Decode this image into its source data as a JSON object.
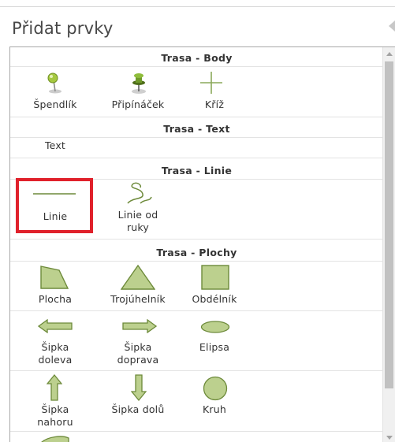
{
  "header": {
    "title": "Přidat prvky"
  },
  "sections": {
    "body": {
      "title": "Trasa - Body",
      "items": [
        {
          "label": "Špendlík",
          "icon": "pushpin-icon"
        },
        {
          "label": "Připínáček",
          "icon": "thumbtack-icon"
        },
        {
          "label": "Kříž",
          "icon": "cross-icon"
        }
      ]
    },
    "text": {
      "title": "Trasa - Text",
      "items": [
        {
          "label": "Text"
        }
      ]
    },
    "linie": {
      "title": "Trasa - Linie",
      "items": [
        {
          "label": "Linie",
          "icon": "line-icon",
          "selected": true
        },
        {
          "label_line1": "Linie od",
          "label_line2": "ruky",
          "icon": "freehand-line-icon"
        }
      ]
    },
    "plochy": {
      "title": "Trasa - Plochy",
      "items": [
        {
          "label": "Plocha",
          "icon": "polygon-icon"
        },
        {
          "label": "Trojúhelník",
          "icon": "triangle-icon"
        },
        {
          "label": "Obdélník",
          "icon": "rectangle-icon"
        },
        {
          "label_line1": "Šipka",
          "label_line2": "doleva",
          "icon": "arrow-left-icon"
        },
        {
          "label_line1": "Šipka",
          "label_line2": "doprava",
          "icon": "arrow-right-icon"
        },
        {
          "label": "Elipsa",
          "icon": "ellipse-icon"
        },
        {
          "label_line1": "Šipka",
          "label_line2": "nahoru",
          "icon": "arrow-up-icon"
        },
        {
          "label": "Šipka dolů",
          "icon": "arrow-down-icon"
        },
        {
          "label": "Kruh",
          "icon": "circle-icon"
        }
      ]
    }
  },
  "colors": {
    "shape_fill": "#bcd08e",
    "shape_stroke": "#6d8a3a",
    "highlight_border": "#e0212b"
  }
}
